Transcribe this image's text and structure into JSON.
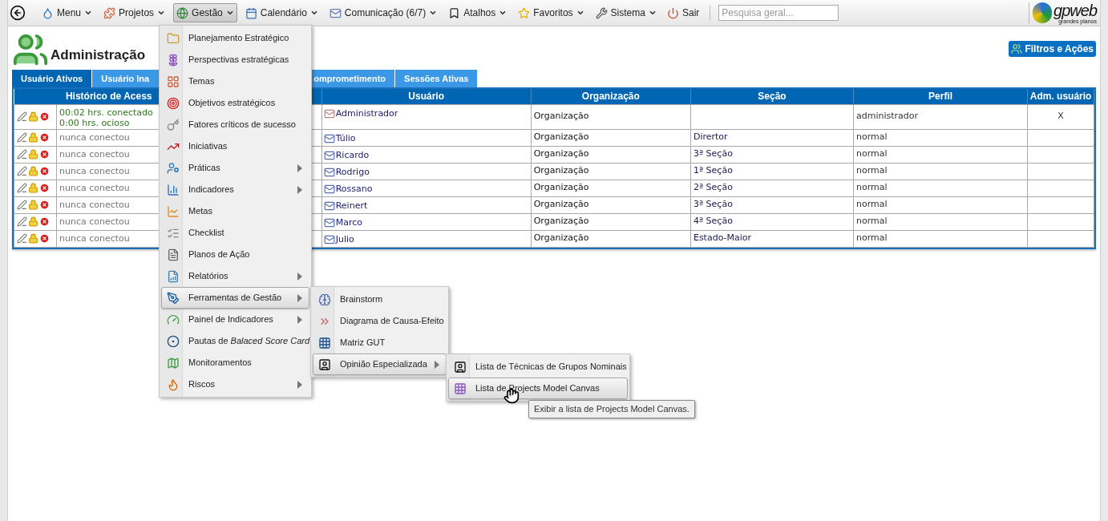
{
  "toolbar": {
    "items": [
      {
        "label": "Menu",
        "active": false
      },
      {
        "label": "Projetos",
        "active": false
      },
      {
        "label": "Gestão",
        "active": true
      },
      {
        "label": "Calendário",
        "active": false
      },
      {
        "label": "Comunicação (6/7)",
        "active": false
      },
      {
        "label": "Atalhos",
        "active": false
      },
      {
        "label": "Favoritos",
        "active": false
      },
      {
        "label": "Sistema",
        "active": false
      }
    ],
    "exit": "Sair",
    "search": {
      "placeholder": "Pesquisa geral..."
    },
    "logo": {
      "text": "gpweb",
      "subtitle": "grandes planos"
    }
  },
  "page": {
    "title": "Administração",
    "action_button": "Filtros e Ações"
  },
  "tabs": [
    {
      "label": "Usuário Ativos",
      "selected": true
    },
    {
      "label": "Usuário Ina",
      "selected": false
    },
    {
      "label": "omprometimento",
      "selected": false
    },
    {
      "label": "Sessões Ativas",
      "selected": false
    }
  ],
  "table": {
    "columns": [
      "Histórico de Acess",
      "",
      "Usuário",
      "Organização",
      "Seção",
      "Perfil",
      "Adm. usuário"
    ],
    "rows": [
      {
        "history": [
          "00:02 hrs. conectado",
          "0:00 hrs. ocioso"
        ],
        "connected": true,
        "user": "Administrador",
        "organization": "Organização",
        "section": "",
        "profile": "administrador",
        "admin": "X"
      },
      {
        "history": [
          "nunca conectou"
        ],
        "connected": false,
        "user": "Túlio",
        "organization": "Organização",
        "section": "Dirertor",
        "profile": "normal",
        "admin": ""
      },
      {
        "history": [
          "nunca conectou"
        ],
        "connected": false,
        "user": "Ricardo",
        "organization": "Organização",
        "section": "3ª Seção",
        "profile": "normal",
        "admin": ""
      },
      {
        "history": [
          "nunca conectou"
        ],
        "connected": false,
        "user": "Rodrigo",
        "organization": "Organização",
        "section": "1ª Seção",
        "profile": "normal",
        "admin": ""
      },
      {
        "history": [
          "nunca conectou"
        ],
        "connected": false,
        "user": "Rossano",
        "organization": "Organização",
        "section": "2ª Seção",
        "profile": "normal",
        "admin": ""
      },
      {
        "history": [
          "nunca conectou"
        ],
        "connected": false,
        "user": "Reinert",
        "organization": "Organização",
        "section": "3ª Seção",
        "profile": "normal",
        "admin": ""
      },
      {
        "history": [
          "nunca conectou"
        ],
        "connected": false,
        "user": "Marco",
        "organization": "Organização",
        "section": "4ª Seção",
        "profile": "normal",
        "admin": ""
      },
      {
        "history": [
          "nunca conectou"
        ],
        "connected": false,
        "user": "Julio",
        "organization": "Organização",
        "section": "Estado-Maior",
        "profile": "normal",
        "admin": ""
      }
    ]
  },
  "menu": {
    "items": [
      {
        "label": "Planejamento Estratégico",
        "submenu": false,
        "selected": false
      },
      {
        "label": "Perspectivas estratégicas",
        "submenu": false,
        "selected": false
      },
      {
        "label": "Temas",
        "submenu": false,
        "selected": false
      },
      {
        "label": "Objetivos estratégicos",
        "submenu": false,
        "selected": false
      },
      {
        "label": "Fatores críticos de sucesso",
        "submenu": false,
        "selected": false
      },
      {
        "label": "Iniciativas",
        "submenu": false,
        "selected": false
      },
      {
        "label": "Práticas",
        "submenu": true,
        "selected": false
      },
      {
        "label": "Indicadores",
        "submenu": true,
        "selected": false
      },
      {
        "label": "Metas",
        "submenu": false,
        "selected": false
      },
      {
        "label": "Checklist",
        "submenu": false,
        "selected": false
      },
      {
        "label": "Planos de Ação",
        "submenu": false,
        "selected": false
      },
      {
        "label": "Relatórios",
        "submenu": true,
        "selected": false
      },
      {
        "label": "Ferramentas de Gestão",
        "submenu": true,
        "selected": true
      },
      {
        "label": "Painel de Indicadores",
        "submenu": true,
        "selected": false
      },
      {
        "label": "Pautas de *Balaced Score Card*",
        "submenu": false,
        "selected": false
      },
      {
        "label": "Monitoramentos",
        "submenu": false,
        "selected": false
      },
      {
        "label": "Riscos",
        "submenu": true,
        "selected": false
      }
    ]
  },
  "submenu": {
    "items": [
      {
        "label": "Brainstorm",
        "submenu": false,
        "selected": false
      },
      {
        "label": "Diagrama de Causa-Efeito",
        "submenu": false,
        "selected": false
      },
      {
        "label": "Matriz GUT",
        "submenu": false,
        "selected": false
      },
      {
        "label": "Opinião Especializada",
        "submenu": true,
        "selected": true
      }
    ]
  },
  "subsubmenu": {
    "items": [
      {
        "label": "Lista de Técnicas de Grupos Nominais",
        "submenu": false,
        "selected": false
      },
      {
        "label": "Lista de Projects Model Canvas",
        "submenu": false,
        "selected": true
      }
    ]
  },
  "tooltip": "Exibir a lista de Projects Model Canvas."
}
